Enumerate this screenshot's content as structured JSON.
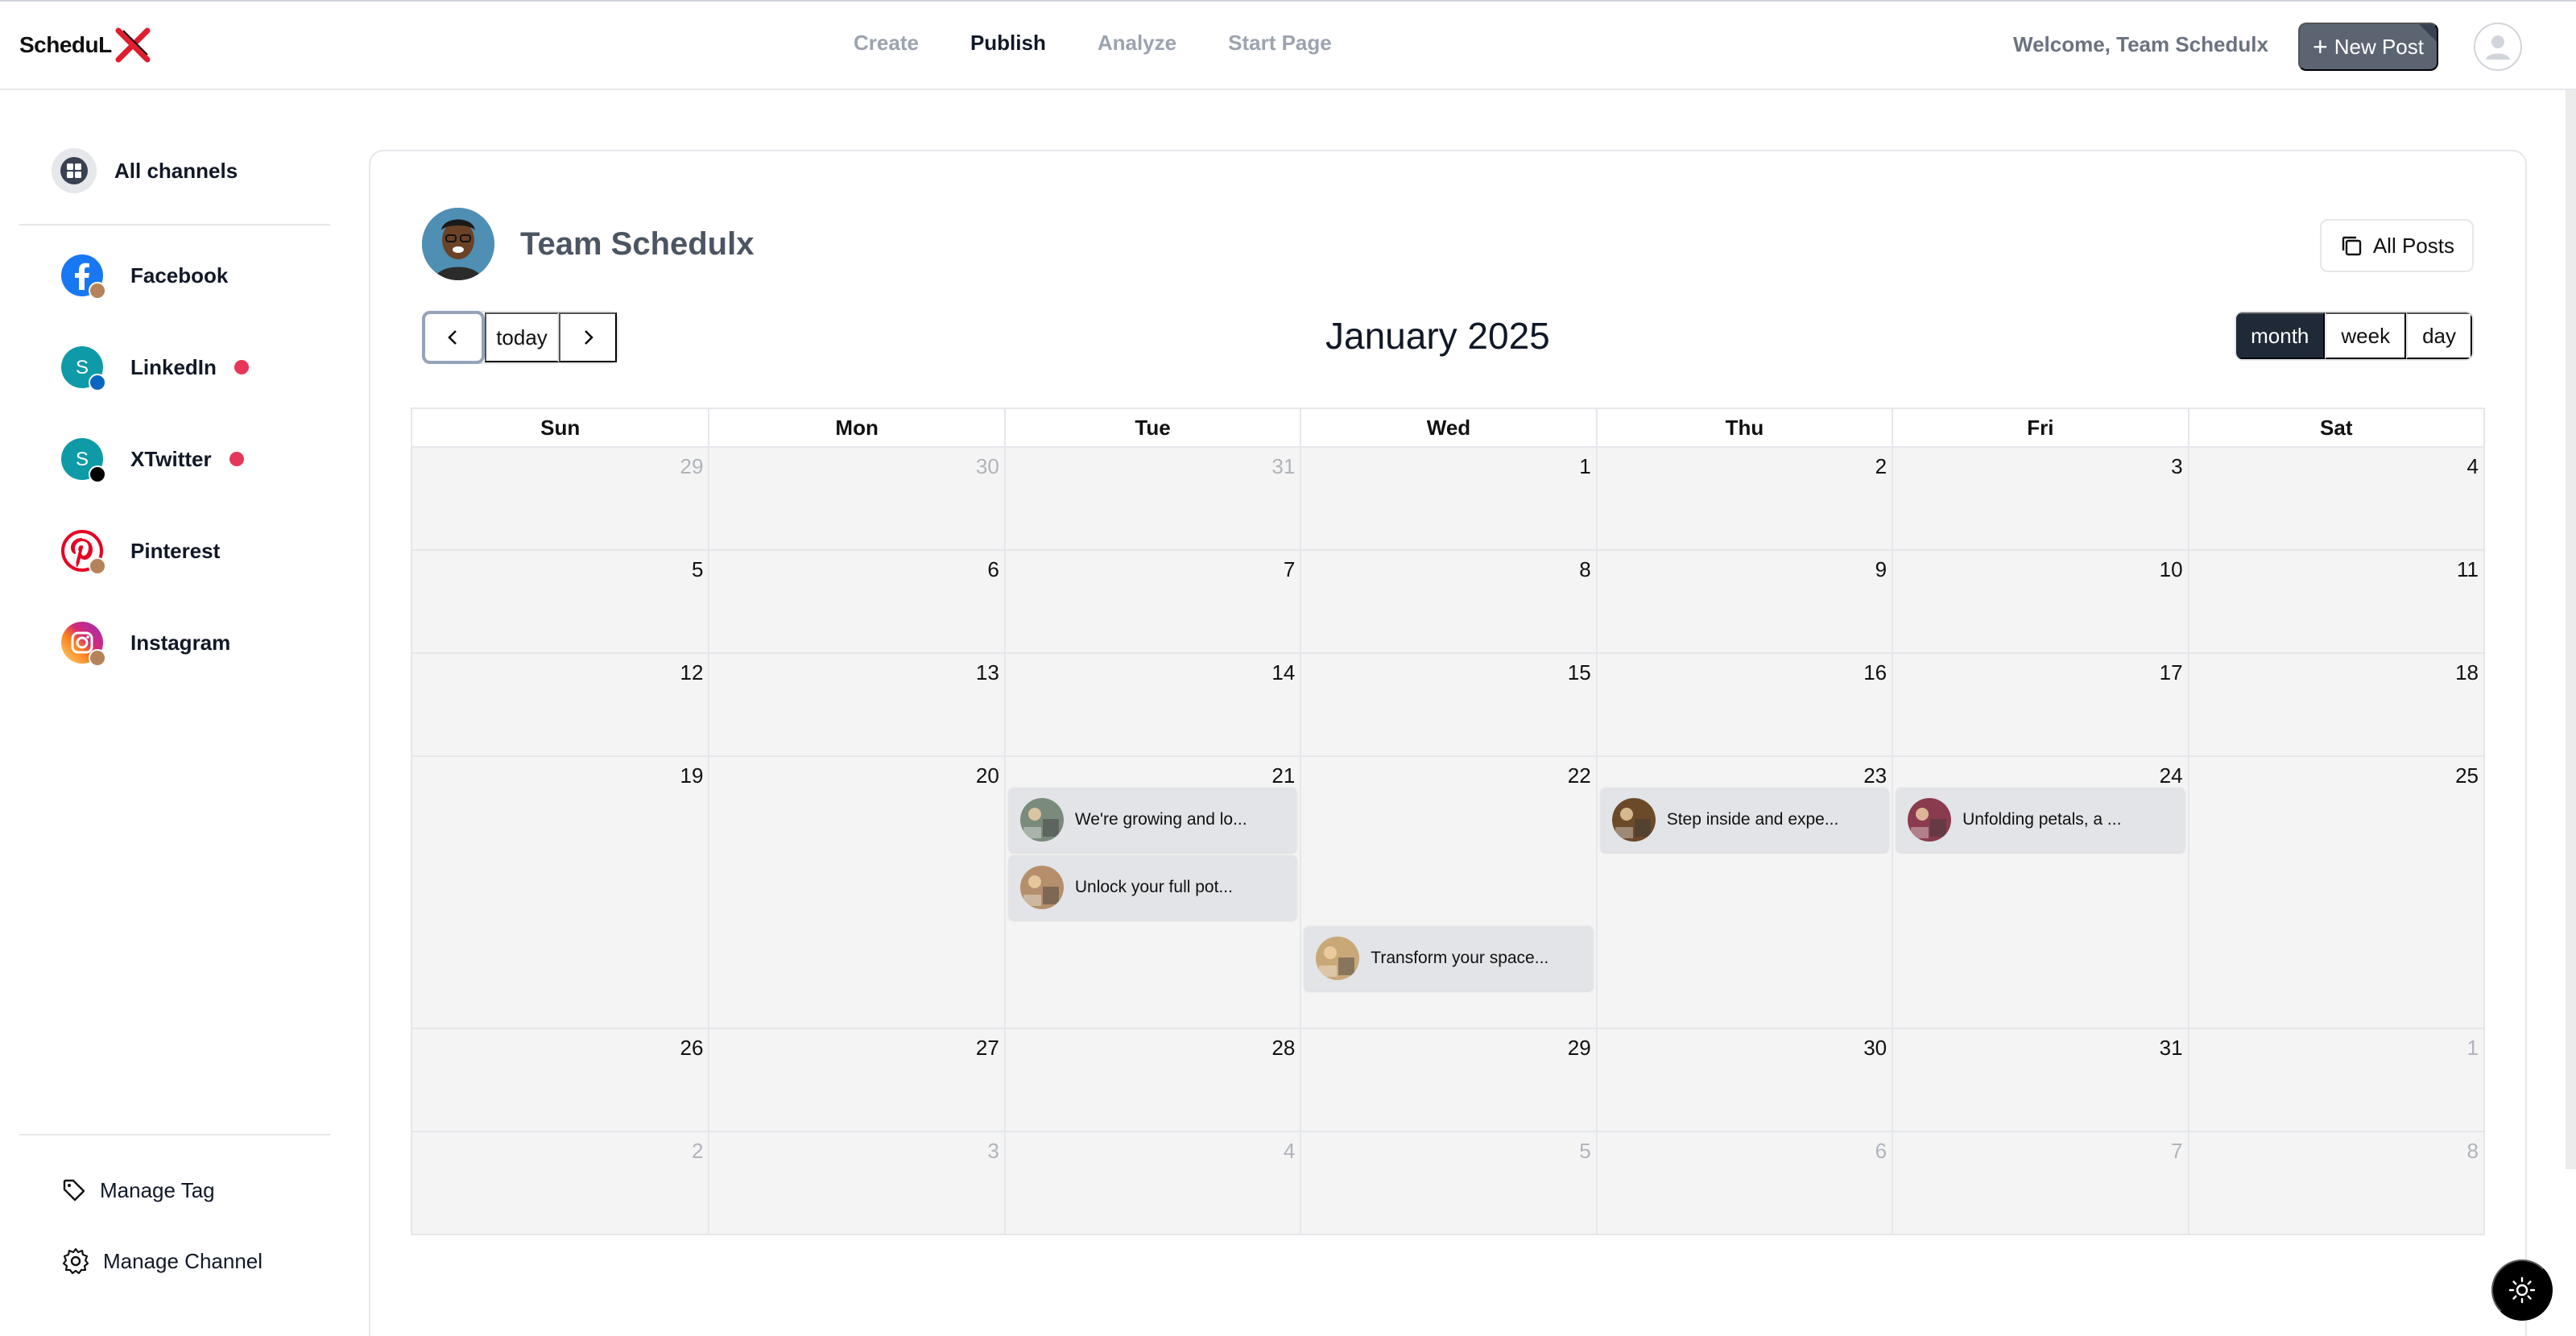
{
  "brand": {
    "name": "ScheduL",
    "logo_letter": "X",
    "accent": "#e11d2e"
  },
  "nav": [
    {
      "label": "Create",
      "active": false
    },
    {
      "label": "Publish",
      "active": true
    },
    {
      "label": "Analyze",
      "active": false
    },
    {
      "label": "Start Page",
      "active": false
    }
  ],
  "header": {
    "welcome": "Welcome, Team Schedulx",
    "new_post": "New Post",
    "new_post_icon": "plus-icon"
  },
  "sidebar": {
    "all_channels": "All channels",
    "channels": [
      {
        "label": "Facebook",
        "icon": "facebook-icon",
        "alert": false,
        "color": "#1877f2"
      },
      {
        "label": "LinkedIn",
        "icon": "linkedin-icon",
        "alert": true,
        "color": "#0e9aa7"
      },
      {
        "label": "XTwitter",
        "icon": "x-twitter-icon",
        "alert": true,
        "color": "#0e9aa7"
      },
      {
        "label": "Pinterest",
        "icon": "pinterest-icon",
        "alert": false,
        "color": "#e60023"
      },
      {
        "label": "Instagram",
        "icon": "instagram-icon",
        "alert": false,
        "color": "#d62976"
      }
    ],
    "initial": "S",
    "manage_tag": "Manage Tag",
    "manage_channel": "Manage Channel"
  },
  "profile": {
    "name": "Team Schedulx"
  },
  "toolbar": {
    "all_posts": "All Posts",
    "today": "today",
    "title": "January 2025",
    "views": [
      "month",
      "week",
      "day"
    ],
    "active_view": "month"
  },
  "calendar": {
    "weekdays": [
      "Sun",
      "Mon",
      "Tue",
      "Wed",
      "Thu",
      "Fri",
      "Sat"
    ],
    "weeks": [
      [
        {
          "d": "29",
          "m": true
        },
        {
          "d": "30",
          "m": true
        },
        {
          "d": "31",
          "m": true
        },
        {
          "d": "1"
        },
        {
          "d": "2"
        },
        {
          "d": "3"
        },
        {
          "d": "4"
        }
      ],
      [
        {
          "d": "5"
        },
        {
          "d": "6"
        },
        {
          "d": "7"
        },
        {
          "d": "8"
        },
        {
          "d": "9"
        },
        {
          "d": "10"
        },
        {
          "d": "11"
        }
      ],
      [
        {
          "d": "12"
        },
        {
          "d": "13"
        },
        {
          "d": "14"
        },
        {
          "d": "15"
        },
        {
          "d": "16"
        },
        {
          "d": "17"
        },
        {
          "d": "18"
        }
      ],
      [
        {
          "d": "19"
        },
        {
          "d": "20"
        },
        {
          "d": "21"
        },
        {
          "d": "22"
        },
        {
          "d": "23"
        },
        {
          "d": "24"
        },
        {
          "d": "25"
        }
      ],
      [
        {
          "d": "26"
        },
        {
          "d": "27"
        },
        {
          "d": "28"
        },
        {
          "d": "29"
        },
        {
          "d": "30"
        },
        {
          "d": "31"
        },
        {
          "d": "1",
          "m": true
        }
      ],
      [
        {
          "d": "2",
          "m": true
        },
        {
          "d": "3",
          "m": true
        },
        {
          "d": "4",
          "m": true
        },
        {
          "d": "5",
          "m": true
        },
        {
          "d": "6",
          "m": true
        },
        {
          "d": "7",
          "m": true
        },
        {
          "d": "8",
          "m": true
        }
      ]
    ],
    "events": [
      {
        "text": "We're growing and lo...",
        "week": 3,
        "col": 2,
        "slot": 0,
        "thumb": "#7a8b7c"
      },
      {
        "text": "Unlock your full pot...",
        "week": 3,
        "col": 2,
        "slot": 1,
        "thumb": "#b58f6b"
      },
      {
        "text": "Transform your space...",
        "week": 3,
        "col": 3,
        "slot": 2,
        "thumb": "#c9a878"
      },
      {
        "text": "Step inside and expe...",
        "week": 3,
        "col": 4,
        "slot": 0,
        "thumb": "#6b4a2a"
      },
      {
        "text": "Unfolding petals, a ...",
        "week": 3,
        "col": 5,
        "slot": 0,
        "thumb": "#8a3b4e"
      }
    ]
  }
}
